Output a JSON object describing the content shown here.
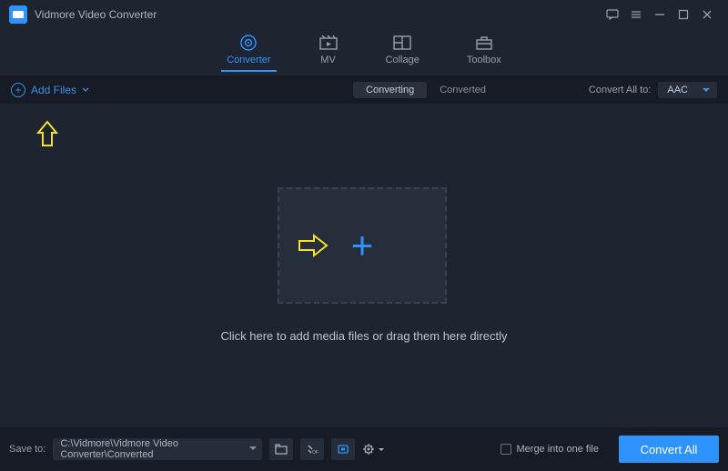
{
  "title": "Vidmore Video Converter",
  "tabs": {
    "converter": "Converter",
    "mv": "MV",
    "collage": "Collage",
    "toolbox": "Toolbox"
  },
  "toolbar": {
    "add_files": "Add Files",
    "converting": "Converting",
    "converted": "Converted",
    "convert_all_to": "Convert All to:",
    "format": "AAC"
  },
  "dropzone": {
    "hint": "Click here to add media files or drag them here directly"
  },
  "footer": {
    "save_to": "Save to:",
    "path": "C:\\Vidmore\\Vidmore Video Converter\\Converted",
    "merge": "Merge into one file",
    "convert": "Convert All"
  }
}
